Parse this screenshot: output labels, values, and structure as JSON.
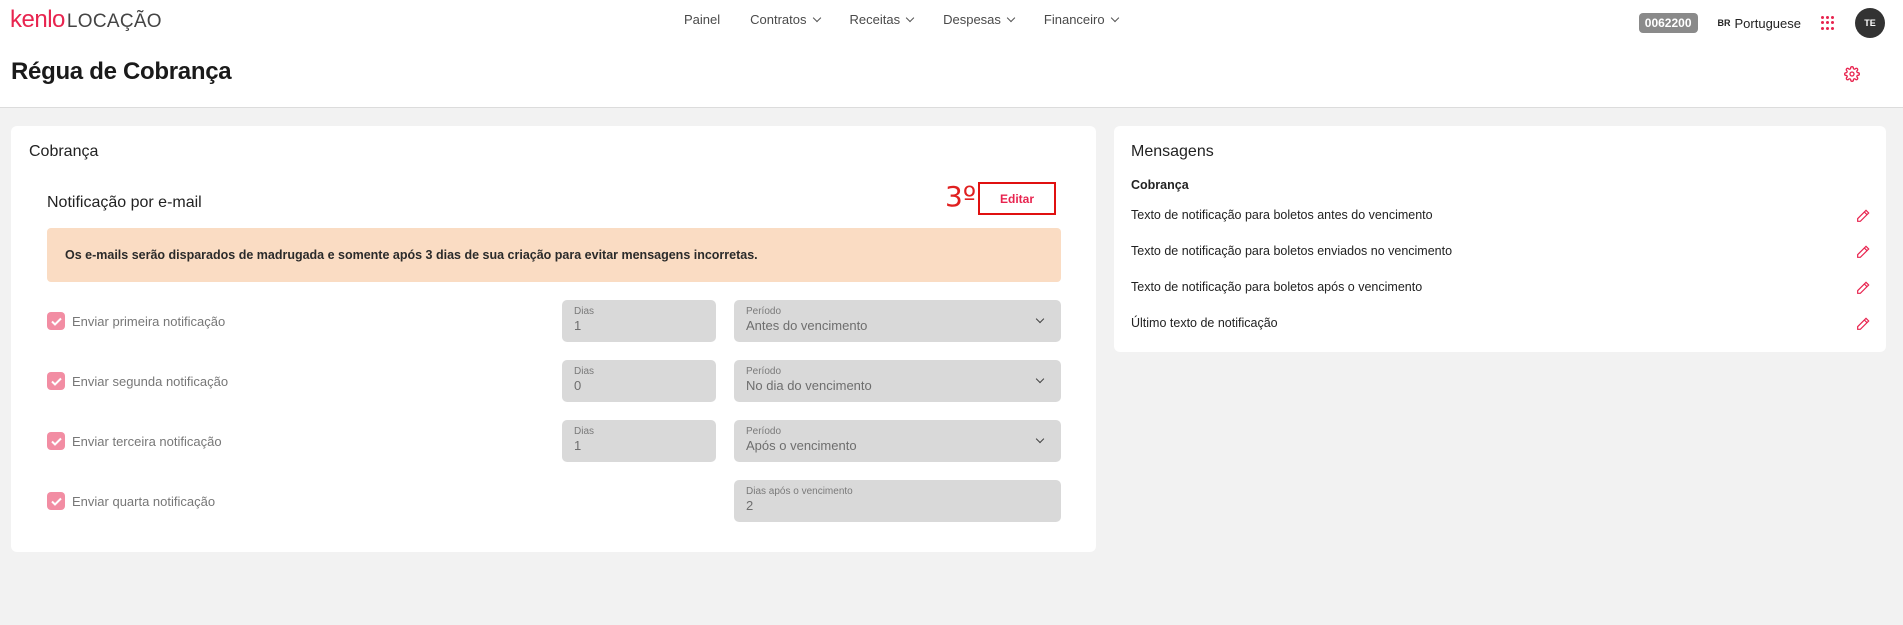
{
  "header": {
    "logo_brand": "kenlo",
    "logo_product": "LOCAÇÃO",
    "nav": [
      {
        "label": "Painel",
        "has_dropdown": false
      },
      {
        "label": "Contratos",
        "has_dropdown": true
      },
      {
        "label": "Receitas",
        "has_dropdown": true
      },
      {
        "label": "Despesas",
        "has_dropdown": true
      },
      {
        "label": "Financeiro",
        "has_dropdown": true
      }
    ],
    "account_code": "0062200",
    "language_flag": "BR",
    "language": "Portuguese",
    "apps_icon": "grid-icon",
    "avatar_initials": "TE"
  },
  "page": {
    "title": "Régua de Cobrança",
    "settings_icon": "gear-icon"
  },
  "cobranca": {
    "card_title": "Cobrança",
    "section_title": "Notificação por e-mail",
    "step_label": "3º",
    "edit_label": "Editar",
    "alert": "Os e-mails serão disparados de madrugada e somente após 3 dias de sua criação para evitar mensagens incorretas.",
    "notifications": [
      {
        "label": "Enviar primeira notificação",
        "checked": true,
        "dias_label": "Dias",
        "dias_value": "1",
        "period_label": "Período",
        "period_value": "Antes do vencimento"
      },
      {
        "label": "Enviar segunda notificação",
        "checked": true,
        "dias_label": "Dias",
        "dias_value": "0",
        "period_label": "Período",
        "period_value": "No dia do vencimento"
      },
      {
        "label": "Enviar terceira notificação",
        "checked": true,
        "dias_label": "Dias",
        "dias_value": "1",
        "period_label": "Período",
        "period_value": "Após o vencimento"
      },
      {
        "label": "Enviar quarta notificação",
        "checked": true,
        "period_label": "Dias após o vencimento",
        "period_value": "2"
      }
    ]
  },
  "mensagens": {
    "card_title": "Mensagens",
    "subtitle": "Cobrança",
    "items": [
      {
        "label": "Texto de notificação para boletos antes do vencimento"
      },
      {
        "label": "Texto de notificação para boletos enviados no vencimento"
      },
      {
        "label": "Texto de notificação para boletos após o vencimento"
      },
      {
        "label": "Último texto de notificação"
      }
    ]
  },
  "colors": {
    "brand": "#e8244f",
    "alert_bg": "#fadcc3",
    "checkbox": "#f28da3",
    "field_bg": "#d9d9d9",
    "annotation": "#e01010"
  }
}
